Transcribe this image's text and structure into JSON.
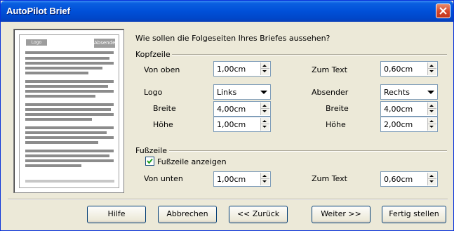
{
  "window": {
    "title": "AutoPilot Brief"
  },
  "preview": {
    "logo": "Logo",
    "sender": "Absender"
  },
  "question": "Wie sollen die Folgeseiten Ihres Briefes aussehen?",
  "header_section": {
    "title": "Kopfzeile",
    "from_top_label": "Von oben",
    "from_top_value": "1,00cm",
    "to_text_label": "Zum Text",
    "to_text_value": "0,60cm",
    "logo_label": "Logo",
    "logo_value": "Links",
    "logo_width_label": "Breite",
    "logo_width_value": "4,00cm",
    "logo_height_label": "Höhe",
    "logo_height_value": "1,00cm",
    "sender_label": "Absender",
    "sender_value": "Rechts",
    "sender_width_label": "Breite",
    "sender_width_value": "4,00cm",
    "sender_height_label": "Höhe",
    "sender_height_value": "2,00cm"
  },
  "footer_section": {
    "title": "Fußzeile",
    "show_footer_label": "Fußzeile anzeigen",
    "show_footer_checked": true,
    "from_bottom_label": "Von unten",
    "from_bottom_value": "1,00cm",
    "to_text_label": "Zum Text",
    "to_text_value": "0,60cm"
  },
  "buttons": {
    "help": "Hilfe",
    "cancel": "Abbrechen",
    "back": "<< Zurück",
    "next": "Weiter >>",
    "finish": "Fertig stellen"
  }
}
